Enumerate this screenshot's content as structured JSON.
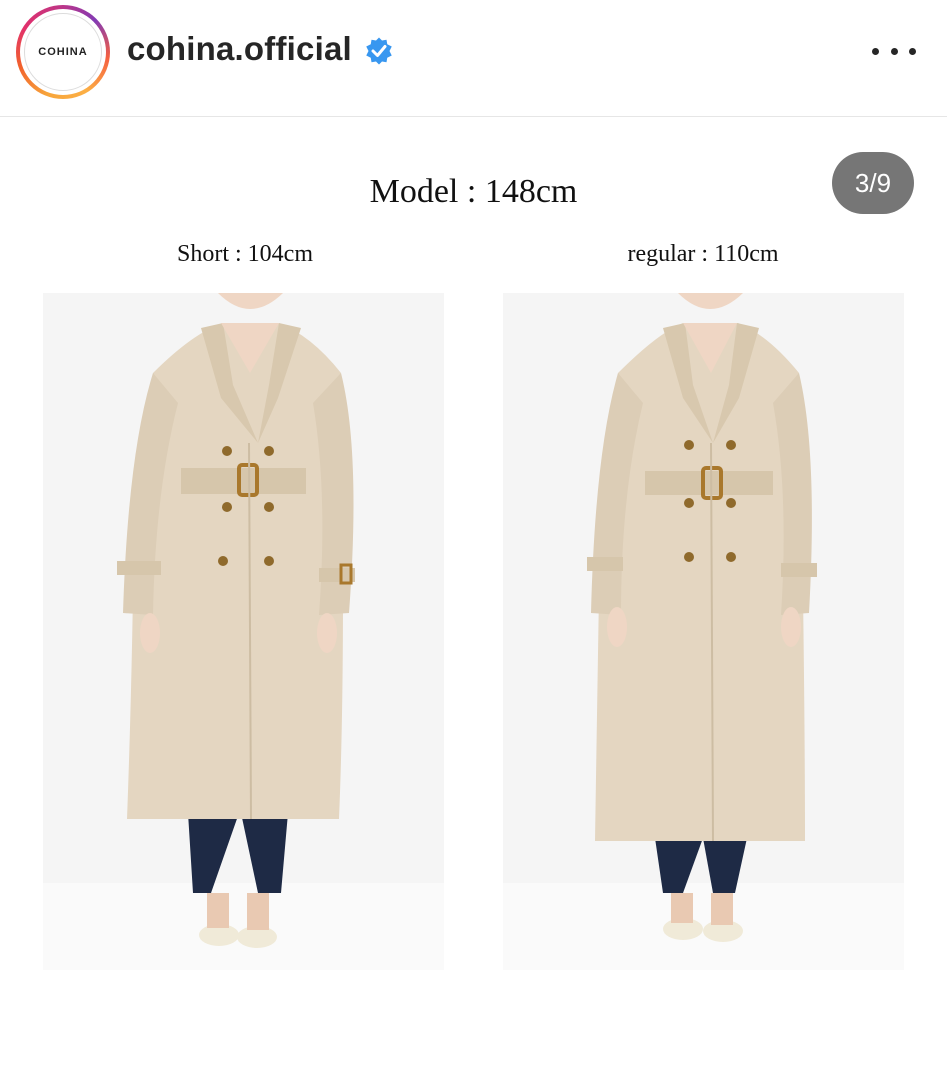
{
  "header": {
    "avatar_text": "COHINA",
    "username": "cohina.official",
    "verified_icon": "verified-badge-icon",
    "more_icon": "more-options-icon"
  },
  "post": {
    "model_text": "Model : 148cm",
    "counter": "3/9",
    "left_label": "Short : 104cm",
    "right_label": "regular : 110cm"
  },
  "colors": {
    "verified_blue": "#3897f0",
    "coat_beige": "#e4d6c1",
    "jeans_navy": "#1e2a45"
  }
}
